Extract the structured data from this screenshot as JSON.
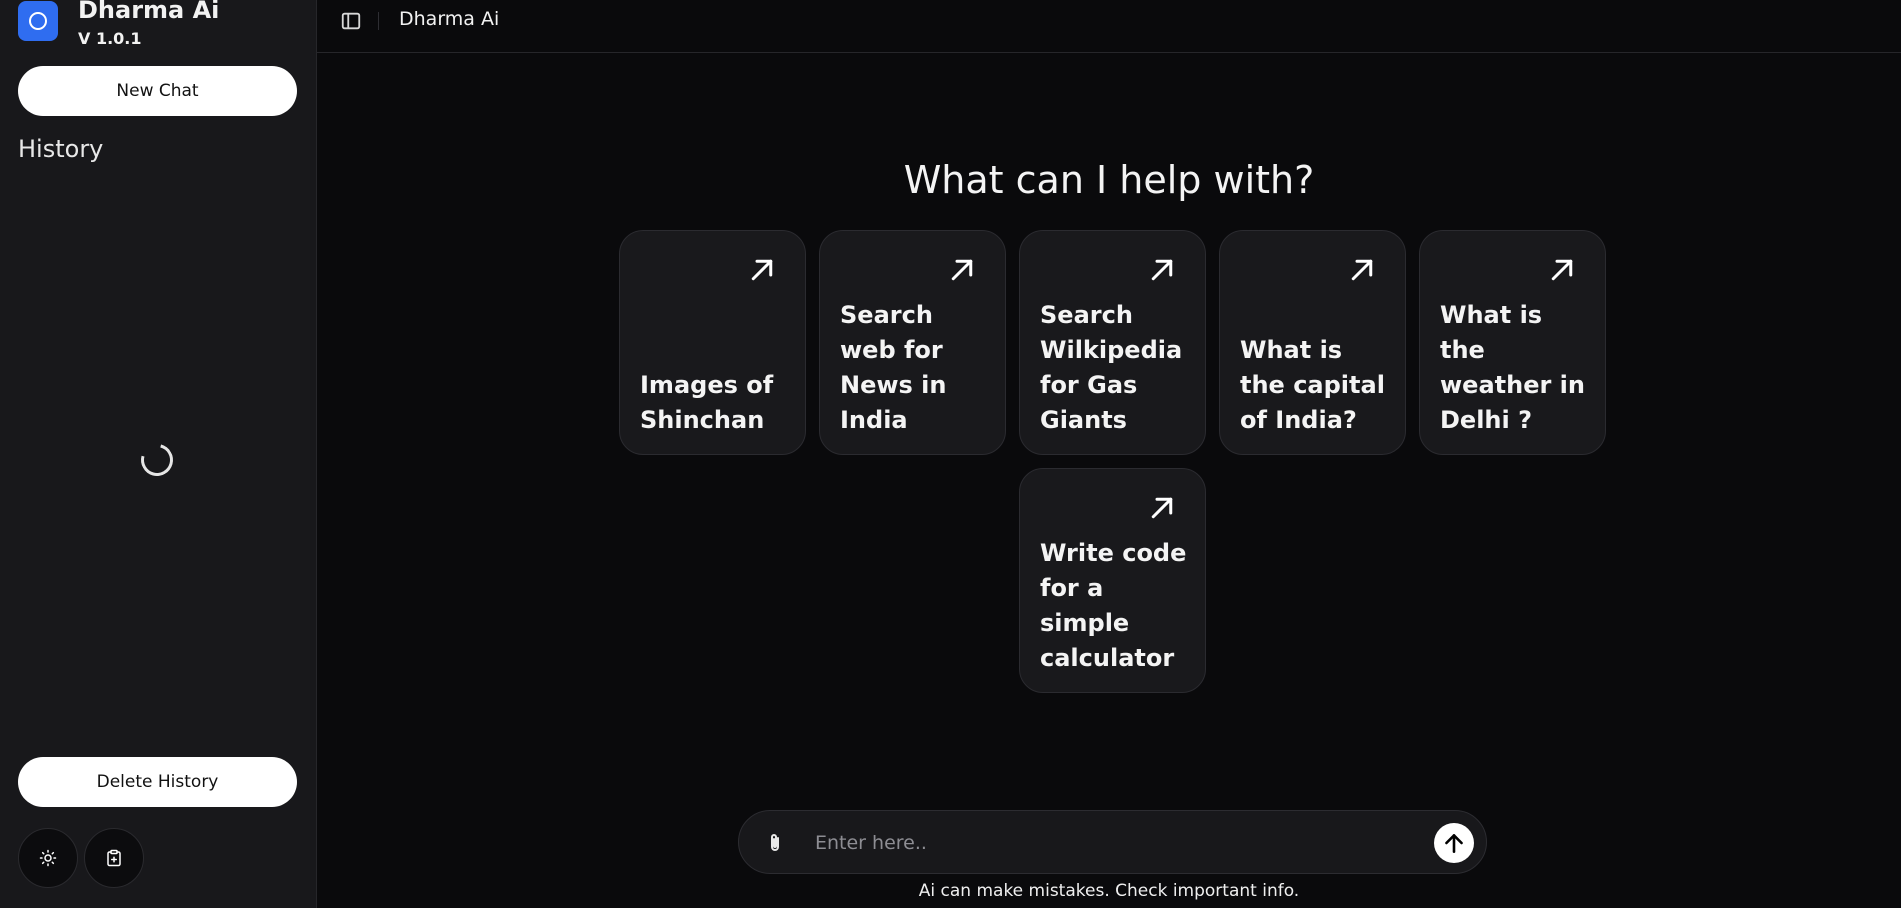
{
  "app": {
    "name": "Dharma Ai",
    "version": "V 1.0.1"
  },
  "sidebar": {
    "new_chat_label": "New Chat",
    "history_title": "History",
    "delete_history_label": "Delete History",
    "footer_icons": [
      "sun-icon",
      "clipboard-plus-icon"
    ]
  },
  "header": {
    "title": "Dharma Ai"
  },
  "main": {
    "heading": "What can I help with?",
    "suggestions": [
      {
        "label": "Images of Shinchan",
        "icon": "arrow-up-right-icon"
      },
      {
        "label": "Search web for News in India",
        "icon": "arrow-up-right-icon"
      },
      {
        "label": "Search Wilkipedia for Gas Giants",
        "icon": "arrow-up-right-icon"
      },
      {
        "label": "What is the capital of India?",
        "icon": "arrow-up-right-icon"
      },
      {
        "label": "What is the weather in Delhi ?",
        "icon": "arrow-up-right-icon"
      },
      {
        "label": "Write code for a simple calculator",
        "icon": "arrow-up-right-icon"
      }
    ]
  },
  "composer": {
    "placeholder": "Enter here..",
    "value": "",
    "disclaimer": "Ai can make mistakes. Check important info."
  },
  "colors": {
    "background": "#0a0a0c",
    "sidebar": "#18181b",
    "accent": "#2f6df0",
    "card": "#19191c"
  }
}
